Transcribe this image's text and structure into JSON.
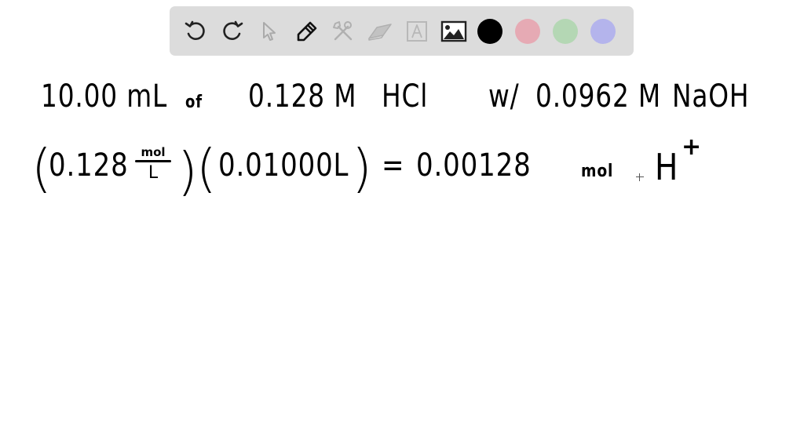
{
  "toolbar": {
    "tools": [
      {
        "name": "undo",
        "icon": "undo-icon",
        "enabled": true
      },
      {
        "name": "redo",
        "icon": "redo-icon",
        "enabled": true
      },
      {
        "name": "select",
        "icon": "pointer-icon",
        "enabled": false
      },
      {
        "name": "pen",
        "icon": "pencil-icon",
        "enabled": true,
        "active": true
      },
      {
        "name": "tools",
        "icon": "tools-icon",
        "enabled": false
      },
      {
        "name": "eraser",
        "icon": "eraser-icon",
        "enabled": false
      },
      {
        "name": "text",
        "icon": "text-box-icon",
        "enabled": false
      },
      {
        "name": "image",
        "icon": "image-icon",
        "enabled": true
      }
    ],
    "colors": [
      {
        "name": "black",
        "hex": "#000000"
      },
      {
        "name": "pink",
        "hex": "#e6aab4"
      },
      {
        "name": "green",
        "hex": "#b4d7b4"
      },
      {
        "name": "lavender",
        "hex": "#b4b4ec"
      }
    ]
  },
  "whiteboard": {
    "line1": {
      "volume": "10.00 mL",
      "of": "of",
      "concentration_acid": "0.128 M",
      "acid": "HCl",
      "with": "w/",
      "concentration_base": "0.0962 M",
      "base": "NaOH"
    },
    "line2": {
      "factor1_value": "0.128",
      "factor1_unit_num": "mol",
      "factor1_unit_den": "L",
      "factor2": "0.01000L",
      "equals": "=",
      "result": "0.00128",
      "result_unit": "mol",
      "species": "H",
      "species_charge": "+"
    }
  }
}
